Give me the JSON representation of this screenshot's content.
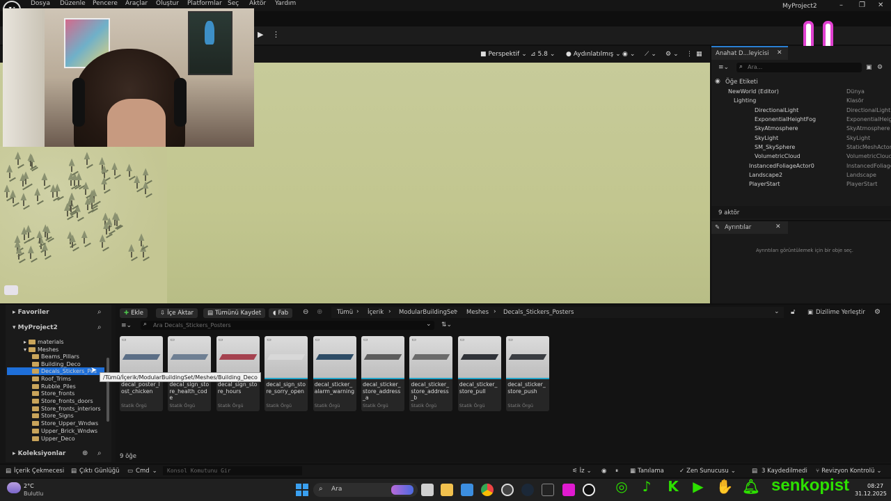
{
  "menu": {
    "items": [
      "Dosya",
      "Düzenle",
      "Pencere",
      "Araçlar",
      "Oluştur",
      "Platformlar",
      "Seç",
      "Aktör",
      "Yardım"
    ],
    "project_title": "MyProject2"
  },
  "viewport": {
    "perspective_label": "Perspektif",
    "fov_label": "5.8",
    "lighting_label": "Aydınlatılmış"
  },
  "outliner": {
    "tab_title": "Anahat D...leyicisi",
    "search_placeholder": "Ara...",
    "column_label": "Öğe Etiketi",
    "rows": [
      {
        "name": "NewWorld (Editor)",
        "type": "Dünya"
      },
      {
        "name": "Lighting",
        "type": "Klasör"
      },
      {
        "name": "DirectionalLight",
        "type": "DirectionalLight"
      },
      {
        "name": "ExponentialHeightFog",
        "type": "ExponentialHeightFog"
      },
      {
        "name": "SkyAtmosphere",
        "type": "SkyAtmosphere"
      },
      {
        "name": "SkyLight",
        "type": "SkyLight"
      },
      {
        "name": "SM_SkySphere",
        "type": "StaticMeshActor"
      },
      {
        "name": "VolumetricCloud",
        "type": "VolumetricCloud"
      },
      {
        "name": "InstancedFoliageActor0",
        "type": "InstancedFoliage"
      },
      {
        "name": "Landscape2",
        "type": "Landscape"
      },
      {
        "name": "PlayerStart",
        "type": "PlayerStart"
      }
    ],
    "count": "9 aktör"
  },
  "details": {
    "tab_title": "Ayrıntılar",
    "empty_text": "Ayrıntıları görüntülemek için bir obje seç."
  },
  "content_browser": {
    "favorites": "Favoriler",
    "project": "MyProject2",
    "collections": "Koleksiyonlar",
    "buttons": {
      "add": "Ekle",
      "import": "İçe Aktar",
      "save_all": "Tümünü Kaydet",
      "fab": "Fab",
      "dock": "Dizilime Yerleştir"
    },
    "breadcrumb": [
      "Tümü",
      "İçerik",
      "ModularBuildingSet",
      "Meshes",
      "Decals_Stickers_Posters"
    ],
    "search_placeholder": "Ara Decals_Stickers_Posters",
    "folders": [
      "materials",
      "Meshes",
      "Beams_Pillars",
      "Building_Deco",
      "Decals_Stickers_Posters",
      "Roof_Trims",
      "Rubble_Piles",
      "Store_fronts",
      "Store_fronts_doors",
      "Store_fronts_interiors",
      "Store_Signs",
      "Store_Upper_Wndws",
      "Upper_Brick_Wndws",
      "Upper_Deco"
    ],
    "tooltip": "/Tümü/İçerik/ModularBuildingSet/Meshes/Building_Deco",
    "assets": [
      {
        "name": "decal_poster_lost_chicken",
        "kind": "Statik Örgü"
      },
      {
        "name": "decal_sign_store_health_code",
        "kind": "Statik Örgü"
      },
      {
        "name": "decal_sign_store_hours",
        "kind": "Statik Örgü"
      },
      {
        "name": "decal_sign_store_sorry_open",
        "kind": "Statik Örgü"
      },
      {
        "name": "decal_sticker_alarm_warning",
        "kind": "Statik Örgü"
      },
      {
        "name": "decal_sticker_store_address_a",
        "kind": "Statik Örgü"
      },
      {
        "name": "decal_sticker_store_address_b",
        "kind": "Statik Örgü"
      },
      {
        "name": "decal_sticker_store_pull",
        "kind": "Statik Örgü"
      },
      {
        "name": "decal_sticker_store_push",
        "kind": "Statik Örgü"
      }
    ],
    "item_count": "9 öğe"
  },
  "statusbar": {
    "content_drawer": "İçerik Çekmecesi",
    "output_log": "Çıktı Günlüğü",
    "cmd": "Cmd",
    "console_placeholder": "Konsol Komutunu Gir",
    "trace": "İz",
    "derive": "Tanılama",
    "zen": "Zen Sunucusu",
    "unsaved": "3 Kaydedilmedi",
    "revision": "Revizyon Kontrolü"
  },
  "taskbar": {
    "weather_temp": "2°C",
    "weather_desc": "Bulutlu",
    "search": "Ara",
    "time": "08:27",
    "date": "31.12.2025"
  },
  "overlay": {
    "channel": "senkopist"
  }
}
